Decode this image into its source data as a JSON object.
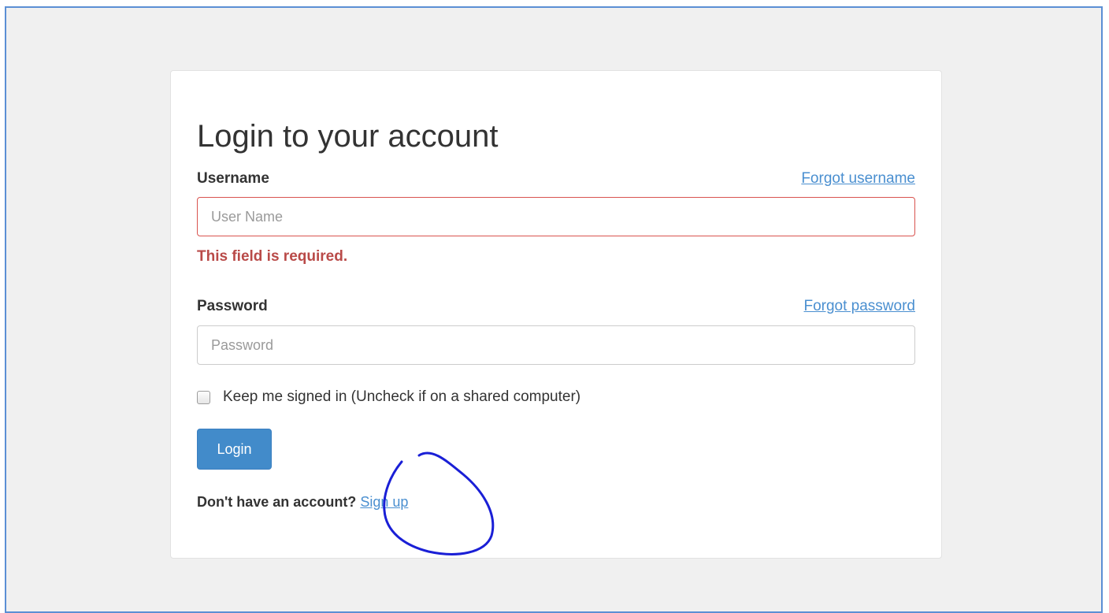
{
  "login_form": {
    "title": "Login to your account",
    "username": {
      "label": "Username",
      "forgot_link": "Forgot username",
      "placeholder": "User Name",
      "value": "",
      "error": "This field is required."
    },
    "password": {
      "label": "Password",
      "forgot_link": "Forgot password",
      "placeholder": "Password",
      "value": ""
    },
    "remember_me": {
      "label": "Keep me signed in (Uncheck if on a shared computer)",
      "checked": false
    },
    "submit_label": "Login",
    "signup": {
      "prompt": "Don't have an account?",
      "link": "Sign up"
    }
  },
  "annotation": {
    "shape": "freehand-circle",
    "target": "Sign up",
    "color": "#1a1fd6"
  },
  "colors": {
    "background": "#f0f0f0",
    "frame_border": "#5b8fd4",
    "primary_button": "#428bca",
    "link": "#4a8fd0",
    "error_text": "#b94a48",
    "error_border": "#d9534f"
  }
}
